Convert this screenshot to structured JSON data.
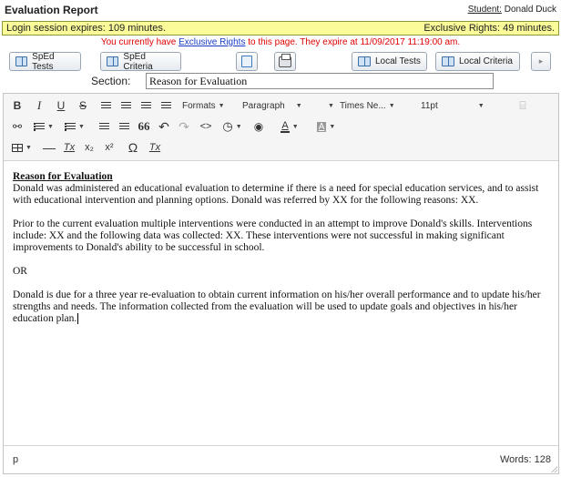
{
  "header": {
    "title": "Evaluation Report",
    "student_label": "Student:",
    "student_name": "Donald Duck"
  },
  "session": {
    "expires_text": "Login session expires: 109 minutes.",
    "rights_text": "Exclusive Rights: 49 minutes."
  },
  "rights_message": {
    "before": "You currently have ",
    "link": "Exclusive Rights",
    "after": " to this page. They expire at 11/09/2017 11:19:00 am."
  },
  "buttons": {
    "sped_tests": "SpEd Tests",
    "sped_criteria": "SpEd Criteria",
    "local_tests": "Local Tests",
    "local_criteria": "Local Criteria",
    "next": "▸"
  },
  "section": {
    "label": "Section:",
    "value": "Reason for Evaluation"
  },
  "toolbar": {
    "bold": "B",
    "italic": "I",
    "underline": "U",
    "strike": "S",
    "formats": "Formats",
    "paragraph": "Paragraph",
    "font": "Times Ne...",
    "size": "11pt",
    "font_color_letter": "A",
    "bg_color_letter": "A",
    "superscript": "x²",
    "subscript": "x₂",
    "omega": "Ω",
    "clear_format": "Tx",
    "blockquote": "66",
    "code": "<>"
  },
  "document": {
    "heading": "Reason for Evaluation",
    "paragraphs": [
      "Donald was administered an educational evaluation to determine if there is a need for special education services, and to assist with educational intervention and planning options. Donald was referred by XX for the following reasons: XX.",
      "Prior to the current evaluation multiple interventions were conducted in an attempt to improve Donald's skills. Interventions include: XX and the following data was collected: XX. These interventions were not successful in making significant improvements to Donald's ability to be successful in school.",
      "OR",
      "Donald is due for a three year re-evaluation to obtain current information on his/her overall performance and to update his/her strengths and needs.  The information collected from the evaluation will be used to update goals and objectives in his/her education plan."
    ]
  },
  "statusbar": {
    "path": "p",
    "words": "Words: 128"
  }
}
